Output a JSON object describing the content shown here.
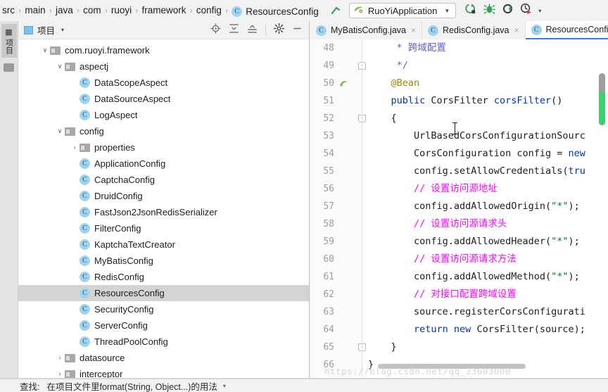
{
  "breadcrumb": {
    "items": [
      "src",
      "main",
      "java",
      "com",
      "ruoyi",
      "framework",
      "config"
    ],
    "separator": "›",
    "current_class": "ResourcesConfig",
    "class_icon": "C"
  },
  "toolbar": {
    "up_arrow_icon": "navigate-up-icon",
    "run_configuration": "RuoYiApplication",
    "run_config_caret": "▼",
    "icons": [
      "run-icon",
      "debug-icon",
      "run-with-coverage-icon",
      "profiler-icon"
    ],
    "overflow_caret": "▾"
  },
  "left_strip": {
    "project_tab": "项目",
    "structure_icon": "structure-icon",
    "favorites_icon": "favorites-folder-icon"
  },
  "project_panel": {
    "title": "项目",
    "caret": "▾",
    "tool_icons": [
      "locate-icon",
      "expand-all-icon",
      "collapse-all-icon",
      "settings-gear-icon",
      "hide-icon"
    ],
    "tree": [
      {
        "label": "com.ruoyi.framework",
        "type": "package",
        "indent": 1,
        "expander": "⌄",
        "expanded": true
      },
      {
        "label": "aspectj",
        "type": "package",
        "indent": 2,
        "expander": "⌄",
        "expanded": true
      },
      {
        "label": "DataScopeAspect",
        "type": "class",
        "indent": 3,
        "expander": ""
      },
      {
        "label": "DataSourceAspect",
        "type": "class",
        "indent": 3,
        "expander": ""
      },
      {
        "label": "LogAspect",
        "type": "class",
        "indent": 3,
        "expander": ""
      },
      {
        "label": "config",
        "type": "package",
        "indent": 2,
        "expander": "⌄",
        "expanded": true
      },
      {
        "label": "properties",
        "type": "package",
        "indent": 3,
        "expander": "›"
      },
      {
        "label": "ApplicationConfig",
        "type": "class",
        "indent": 3,
        "expander": ""
      },
      {
        "label": "CaptchaConfig",
        "type": "class",
        "indent": 3,
        "expander": ""
      },
      {
        "label": "DruidConfig",
        "type": "class",
        "indent": 3,
        "expander": ""
      },
      {
        "label": "FastJson2JsonRedisSerializer",
        "type": "class",
        "indent": 3,
        "expander": ""
      },
      {
        "label": "FilterConfig",
        "type": "class",
        "indent": 3,
        "expander": ""
      },
      {
        "label": "KaptchaTextCreator",
        "type": "class",
        "indent": 3,
        "expander": ""
      },
      {
        "label": "MyBatisConfig",
        "type": "class",
        "indent": 3,
        "expander": ""
      },
      {
        "label": "RedisConfig",
        "type": "class",
        "indent": 3,
        "expander": ""
      },
      {
        "label": "ResourcesConfig",
        "type": "class",
        "indent": 3,
        "expander": "",
        "selected": true
      },
      {
        "label": "SecurityConfig",
        "type": "class",
        "indent": 3,
        "expander": ""
      },
      {
        "label": "ServerConfig",
        "type": "class",
        "indent": 3,
        "expander": ""
      },
      {
        "label": "ThreadPoolConfig",
        "type": "class",
        "indent": 3,
        "expander": ""
      },
      {
        "label": "datasource",
        "type": "package",
        "indent": 2,
        "expander": "›"
      },
      {
        "label": "interceptor",
        "type": "package",
        "indent": 2,
        "expander": "›"
      }
    ]
  },
  "editor": {
    "tabs": [
      {
        "label": "MyBatisConfig.java",
        "icon": "C",
        "active": false,
        "close": "×"
      },
      {
        "label": "RedisConfig.java",
        "icon": "C",
        "active": false,
        "close": "×"
      },
      {
        "label": "ResourcesConfig.java",
        "icon": "C",
        "active": true,
        "close": "×"
      }
    ],
    "first_line_number": 48,
    "lines": [
      {
        "n": 48,
        "fold": "",
        "marker": "",
        "tokens": [
          {
            "t": "     * 跨域配置",
            "c": "jd"
          }
        ]
      },
      {
        "n": 49,
        "fold": "top",
        "marker": "",
        "tokens": [
          {
            "t": "     */",
            "c": "jd"
          }
        ]
      },
      {
        "n": 50,
        "fold": "",
        "marker": "spring-bean-icon",
        "tokens": [
          {
            "t": "    @Bean",
            "c": "an"
          }
        ]
      },
      {
        "n": 51,
        "fold": "",
        "marker": "",
        "tokens": [
          {
            "t": "    ",
            "c": "pl"
          },
          {
            "t": "public",
            "c": "k"
          },
          {
            "t": " CorsFilter ",
            "c": "pl"
          },
          {
            "t": "corsFilter",
            "c": "k"
          },
          {
            "t": "()",
            "c": "pl"
          }
        ]
      },
      {
        "n": 52,
        "fold": "bot",
        "marker": "",
        "tokens": [
          {
            "t": "    {",
            "c": "pl"
          }
        ]
      },
      {
        "n": 53,
        "fold": "",
        "marker": "",
        "tokens": [
          {
            "t": "        UrlBasedCorsConfigurationSourc",
            "c": "pl"
          }
        ]
      },
      {
        "n": 54,
        "fold": "",
        "marker": "",
        "tokens": [
          {
            "t": "        CorsConfiguration config = ",
            "c": "pl"
          },
          {
            "t": "new",
            "c": "k"
          }
        ]
      },
      {
        "n": 55,
        "fold": "",
        "marker": "",
        "tokens": [
          {
            "t": "        config.setAllowCredentials(",
            "c": "pl"
          },
          {
            "t": "tru",
            "c": "k"
          }
        ]
      },
      {
        "n": 56,
        "fold": "",
        "marker": "",
        "tokens": [
          {
            "t": "        // 设置访问源地址",
            "c": "cm"
          }
        ]
      },
      {
        "n": 57,
        "fold": "",
        "marker": "",
        "tokens": [
          {
            "t": "        config.addAllowedOrigin(",
            "c": "pl"
          },
          {
            "t": "\"*\"",
            "c": "st"
          },
          {
            "t": ");",
            "c": "pl"
          }
        ]
      },
      {
        "n": 58,
        "fold": "",
        "marker": "",
        "tokens": [
          {
            "t": "        // 设置访问源请求头",
            "c": "cm"
          }
        ]
      },
      {
        "n": 59,
        "fold": "",
        "marker": "",
        "tokens": [
          {
            "t": "        config.addAllowedHeader(",
            "c": "pl"
          },
          {
            "t": "\"*\"",
            "c": "st"
          },
          {
            "t": ");",
            "c": "pl"
          }
        ]
      },
      {
        "n": 60,
        "fold": "",
        "marker": "",
        "tokens": [
          {
            "t": "        // 设置访问源请求方法",
            "c": "cm"
          }
        ]
      },
      {
        "n": 61,
        "fold": "",
        "marker": "",
        "tokens": [
          {
            "t": "        config.addAllowedMethod(",
            "c": "pl"
          },
          {
            "t": "\"*\"",
            "c": "st"
          },
          {
            "t": ");",
            "c": "pl"
          }
        ]
      },
      {
        "n": 62,
        "fold": "",
        "marker": "",
        "tokens": [
          {
            "t": "        // 对接口配置跨域设置",
            "c": "cm"
          }
        ]
      },
      {
        "n": 63,
        "fold": "",
        "marker": "",
        "tokens": [
          {
            "t": "        source.registerCorsConfigurati",
            "c": "pl"
          }
        ]
      },
      {
        "n": 64,
        "fold": "",
        "marker": "",
        "tokens": [
          {
            "t": "        ",
            "c": "pl"
          },
          {
            "t": "return new",
            "c": "k"
          },
          {
            "t": " CorsFilter(source);",
            "c": "pl"
          }
        ]
      },
      {
        "n": 65,
        "fold": "bot",
        "marker": "",
        "tokens": [
          {
            "t": "    }",
            "c": "pl"
          }
        ]
      },
      {
        "n": 66,
        "fold": "",
        "marker": "",
        "tokens": [
          {
            "t": "}",
            "c": "pl"
          }
        ]
      }
    ],
    "watermark": "https://blog.csdn.net/qq_33603000"
  },
  "statusbar": {
    "label": "查找:",
    "text": "在项目文件里format(String, Object...)的用法",
    "caret": "▾"
  },
  "colors": {
    "accent_blue": "#3d7ec7",
    "class_icon_blue": "#9fd3f0",
    "comment_magenta": "#ff00ff",
    "keyword_blue": "#0033b3",
    "string_green": "#067d17",
    "annotation_gold": "#9e880d",
    "scrollbar_green": "#3ecf6e",
    "selection_gray": "#d4d4d4"
  }
}
